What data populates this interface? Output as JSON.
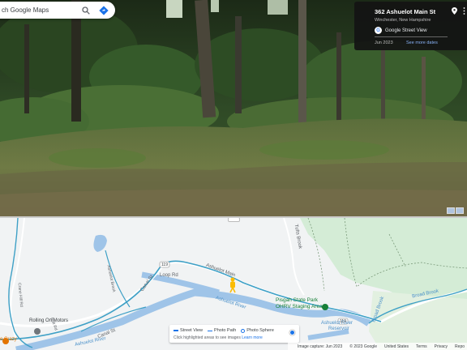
{
  "search": {
    "placeholder": "ch Google Maps"
  },
  "info_card": {
    "address": "362 Ashuelot Main St",
    "region": "Winchester, New Hampshire",
    "brand": "Google Street View",
    "date": "Jun 2023",
    "more_dates": "See more dates",
    "icons": [
      "google-logo-icon",
      "location-pin-icon",
      "menu-dots-icon"
    ]
  },
  "map": {
    "labels": {
      "ashuelot_main": "Ashuelot Main",
      "canal_st": "Canal St",
      "loop_rd": "Loop Rd",
      "canal_st_2": "Canal St",
      "ashuelot_river": "Ashuelot River",
      "ashuelot_river_2": "Ashuelot River",
      "tufts_brook": "Tufts Brook",
      "pisgah_line1": "Pisgah State Park",
      "pisgah_line2": "OHRV Staging Area",
      "broad_brook": "Broad Brook",
      "broad_brook_2": "Broad Brook",
      "reservoir_line1": "Ashuelot River",
      "reservoir_line2": "Reservoir",
      "rolling_on": "Rolling On Motors",
      "crazy": "e Crazy",
      "route_119": "119",
      "route_119b": "119",
      "ashuelot_brook": "Ashuelot Brook",
      "crane_hill": "Crane Hill Rd",
      "bolt_rd": "Bolt Rd"
    },
    "legend": {
      "street_view": "Street View",
      "photo_path": "Photo Path",
      "photo_sphere": "Photo Sphere",
      "hint": "Click highlighted areas to see images",
      "learn_more": "Learn more"
    },
    "footer": {
      "capture": "Image capture: Jun 2023",
      "copyright": "© 2023 Google",
      "country": "United States",
      "terms": "Terms",
      "privacy": "Privacy",
      "report": "Repo"
    }
  },
  "colors": {
    "water": "#4a90c9",
    "park_green": "#d4ecd6",
    "road": "#ffffff",
    "street_view_line": "#3ea0c6",
    "pegman": "#fbbc04"
  }
}
